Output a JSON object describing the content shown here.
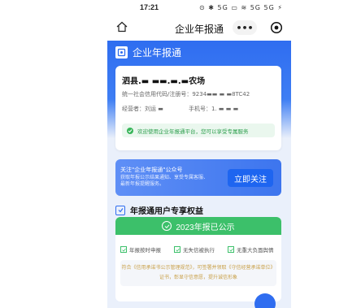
{
  "status_bar": {
    "time": "17:21",
    "indicators": "⊙ ✱ 5G ▭ ≋ 5G 5G ⚡"
  },
  "nav": {
    "title": "企业年报通",
    "more_label": "•••"
  },
  "brand": {
    "name": "企业年报通"
  },
  "company_card": {
    "name": "泗县.▬ ▬▬.▬.▬农场",
    "credit_code": "统一社会信用代码/注册号：9234▬▬ ▬ ▬8TC42",
    "operator": "经营者：刘运 ▬",
    "phone": "手机号：1. ▬ ▬ ▬",
    "welcome": "欢迎使用企业年报通平台，您可以享受专属服务"
  },
  "follow_banner": {
    "title": "关注\"企业年报通\"公众号",
    "subtitle": "获取年报公示结果通知、享受专属客服、最新年报提醒服务。",
    "button": "立即关注"
  },
  "rights": {
    "title": "年报通用户专享权益"
  },
  "annual": {
    "status": "2023年报已公示",
    "features": [
      "年报按时申报",
      "无失信被执行",
      "无重大负面舆情"
    ],
    "description": "符合《信用承诺书公示管理规范》，可签署并领取《守信经营承诺单位》证书，彰显守信意愿，提升诚信形象"
  },
  "colors": {
    "primary": "#2f6df0",
    "success": "#3cc06a",
    "gold_text": "#c9a14a"
  },
  "icons": [
    "home-icon",
    "more-icon",
    "close-icon",
    "logo-icon",
    "check-icon",
    "checkbox-icon",
    "float-button-icon"
  ]
}
